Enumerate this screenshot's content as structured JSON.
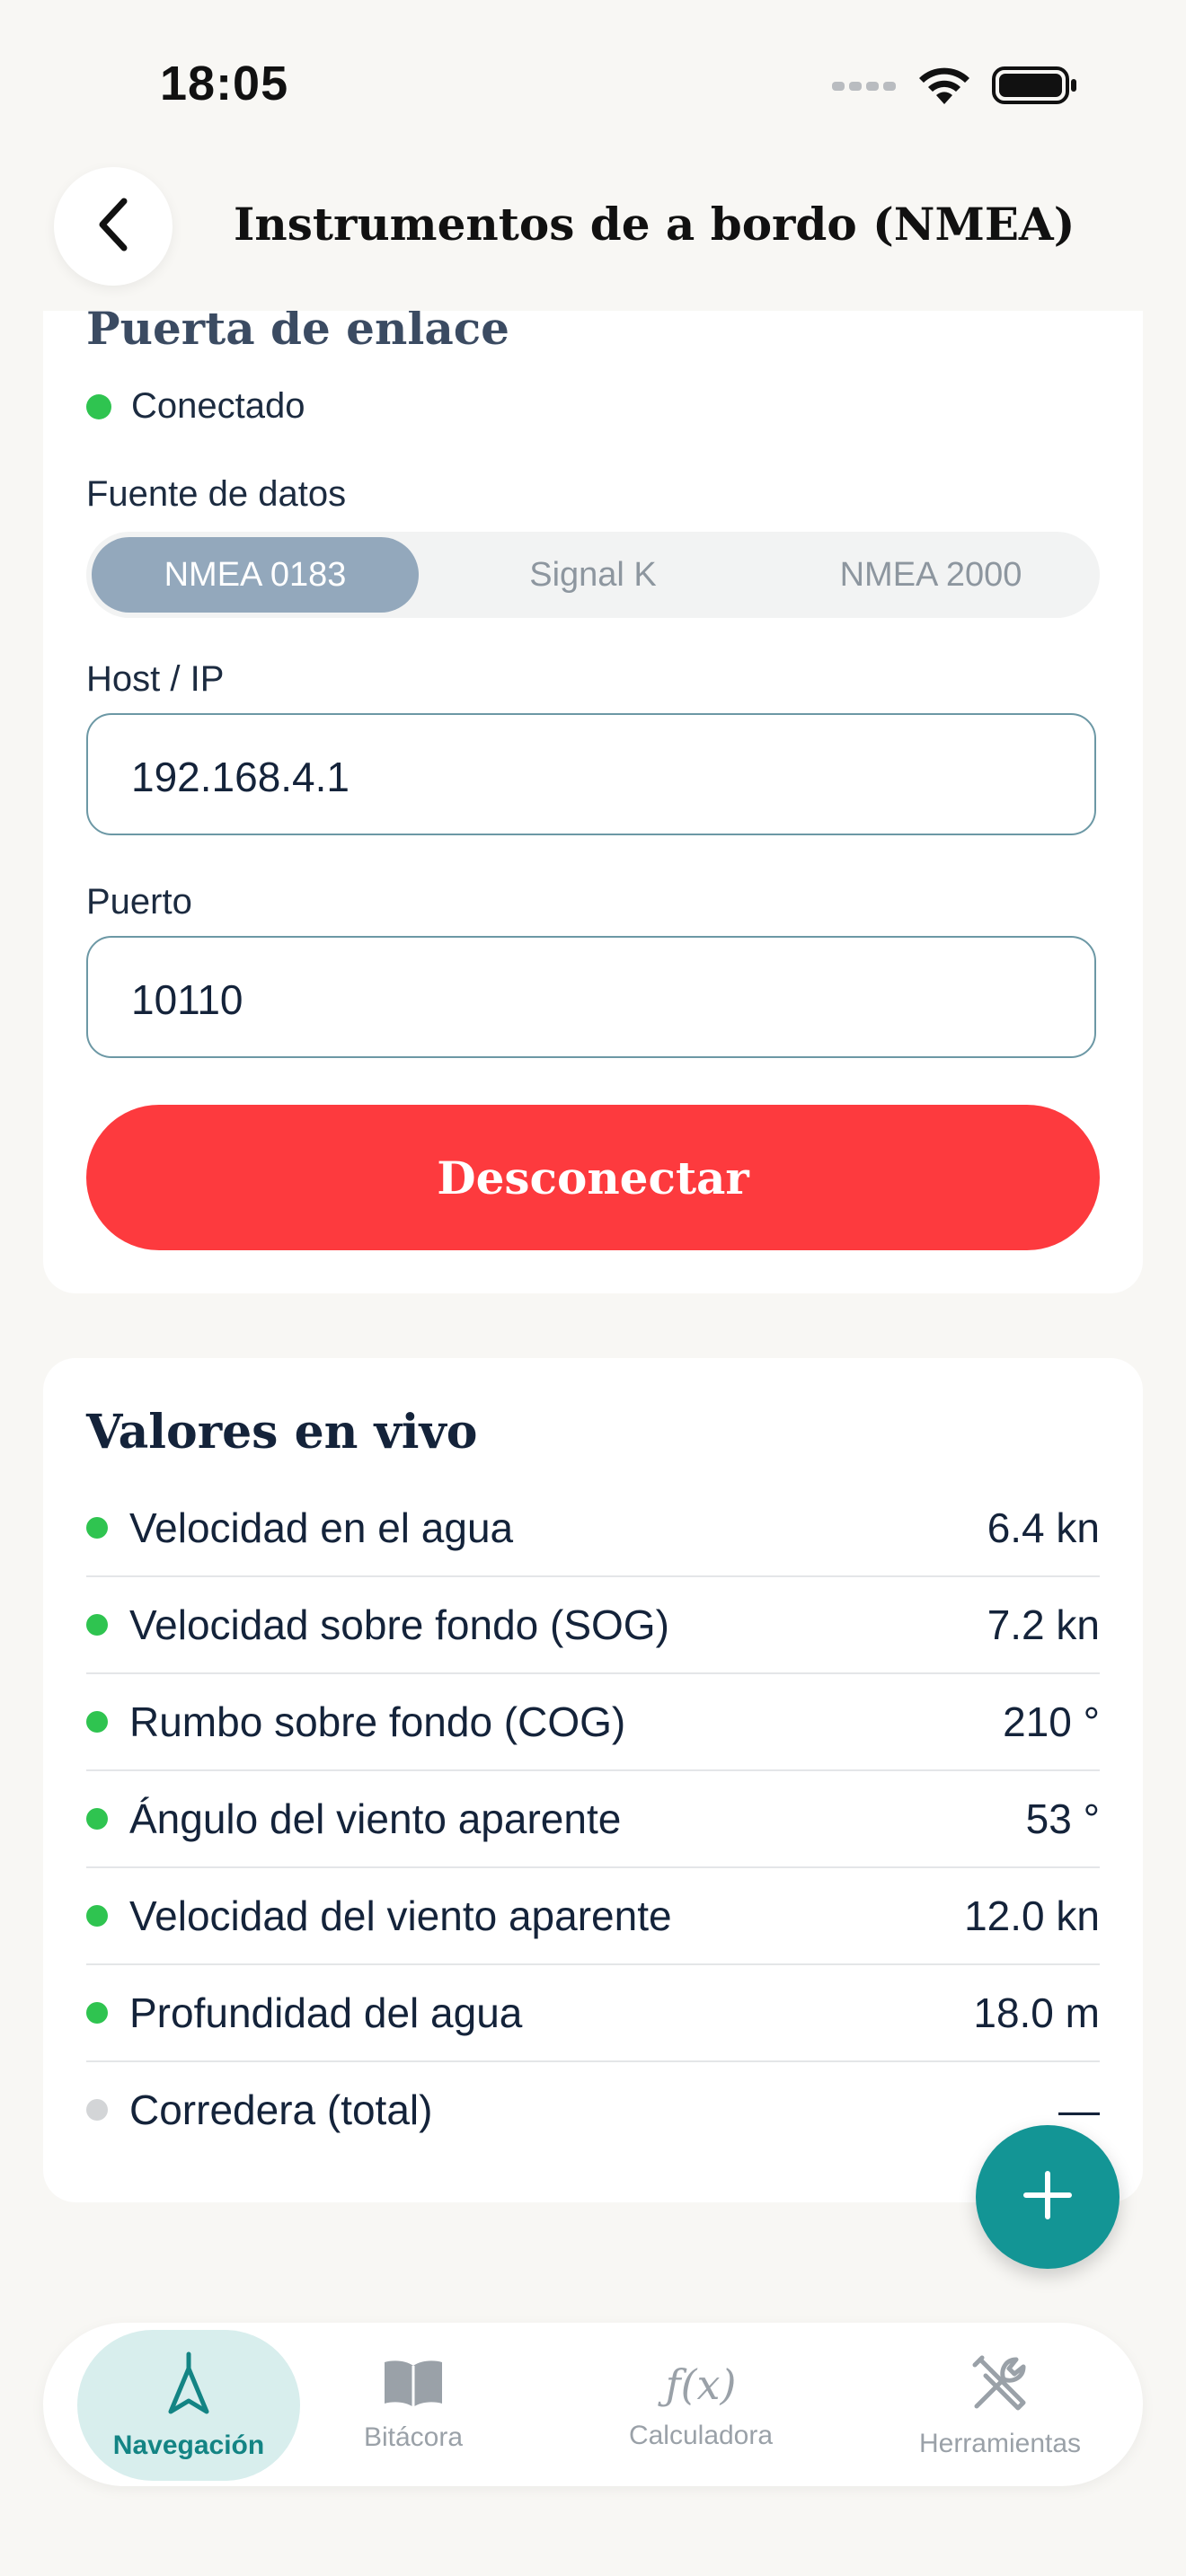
{
  "status": {
    "time": "18:05"
  },
  "header": {
    "title": "Instrumentos de a bordo (NMEA)"
  },
  "gateway": {
    "title": "Puerta de enlace",
    "status": "Conectado",
    "status_color": "#2fc450",
    "source_label": "Fuente de datos",
    "sources": [
      "NMEA 0183",
      "Signal K",
      "NMEA 2000"
    ],
    "selected_source": "NMEA 0183",
    "host_label": "Host / IP",
    "host_value": "192.168.4.1",
    "port_label": "Puerto",
    "port_value": "10110",
    "disconnect_label": "Desconectar",
    "disconnect_color": "#fd3a3e"
  },
  "live": {
    "title": "Valores en vivo",
    "rows": [
      {
        "label": "Velocidad en el agua",
        "value": "6.4 kn",
        "active": true
      },
      {
        "label": "Velocidad sobre fondo (SOG)",
        "value": "7.2 kn",
        "active": true
      },
      {
        "label": "Rumbo sobre fondo (COG)",
        "value": "210 °",
        "active": true
      },
      {
        "label": "Ángulo del viento aparente",
        "value": "53 °",
        "active": true
      },
      {
        "label": "Velocidad del viento aparente",
        "value": "12.0 kn",
        "active": true
      },
      {
        "label": "Profundidad del agua",
        "value": "18.0 m",
        "active": true
      },
      {
        "label": "Corredera (total)",
        "value": "—",
        "active": false
      }
    ]
  },
  "fab": {
    "icon": "plus-icon",
    "color": "#139595"
  },
  "nav": {
    "items": [
      {
        "label": "Navegación",
        "icon": "compass-arrow-icon"
      },
      {
        "label": "Bitácora",
        "icon": "book-icon"
      },
      {
        "label": "Calculadora",
        "icon": "function-icon"
      },
      {
        "label": "Herramientas",
        "icon": "tools-icon"
      }
    ],
    "active": "Navegación"
  }
}
